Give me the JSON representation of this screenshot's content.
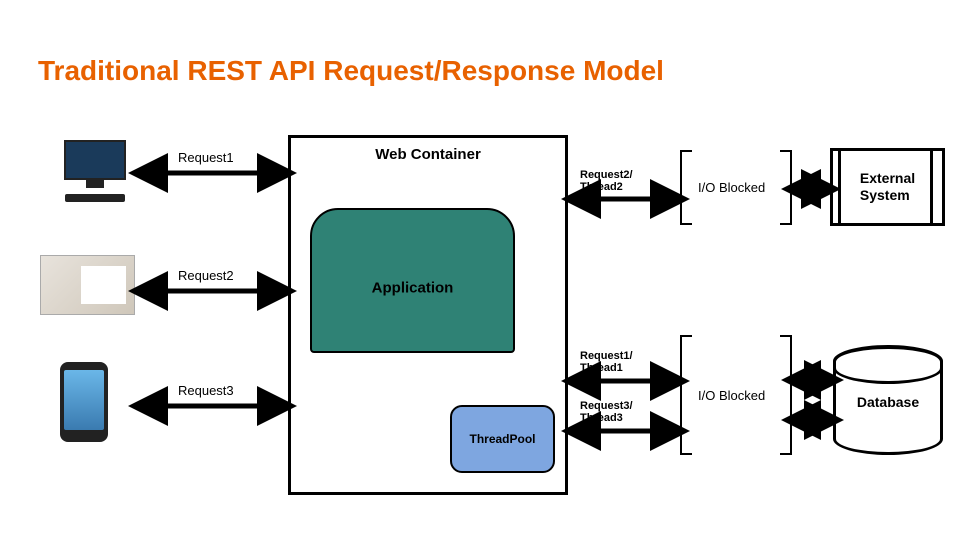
{
  "title": "Traditional REST API Request/Response Model",
  "webContainer": {
    "label": "Web Container"
  },
  "application": {
    "label": "Application"
  },
  "threadPool": {
    "label": "ThreadPool"
  },
  "externalSystem": {
    "line1": "External",
    "line2": "System"
  },
  "database": {
    "label": "Database"
  },
  "clients": {
    "req1": "Request1",
    "req2": "Request2",
    "req3": "Request3"
  },
  "threads": {
    "r2t2a": "Request2/",
    "r2t2b": "Thread2",
    "r1t1a": "Request1/",
    "r1t1b": "Thread1",
    "r3t3a": "Request3/",
    "r3t3b": "Thread3"
  },
  "io": {
    "blocked1": "I/O Blocked",
    "blocked2": "I/O Blocked"
  }
}
